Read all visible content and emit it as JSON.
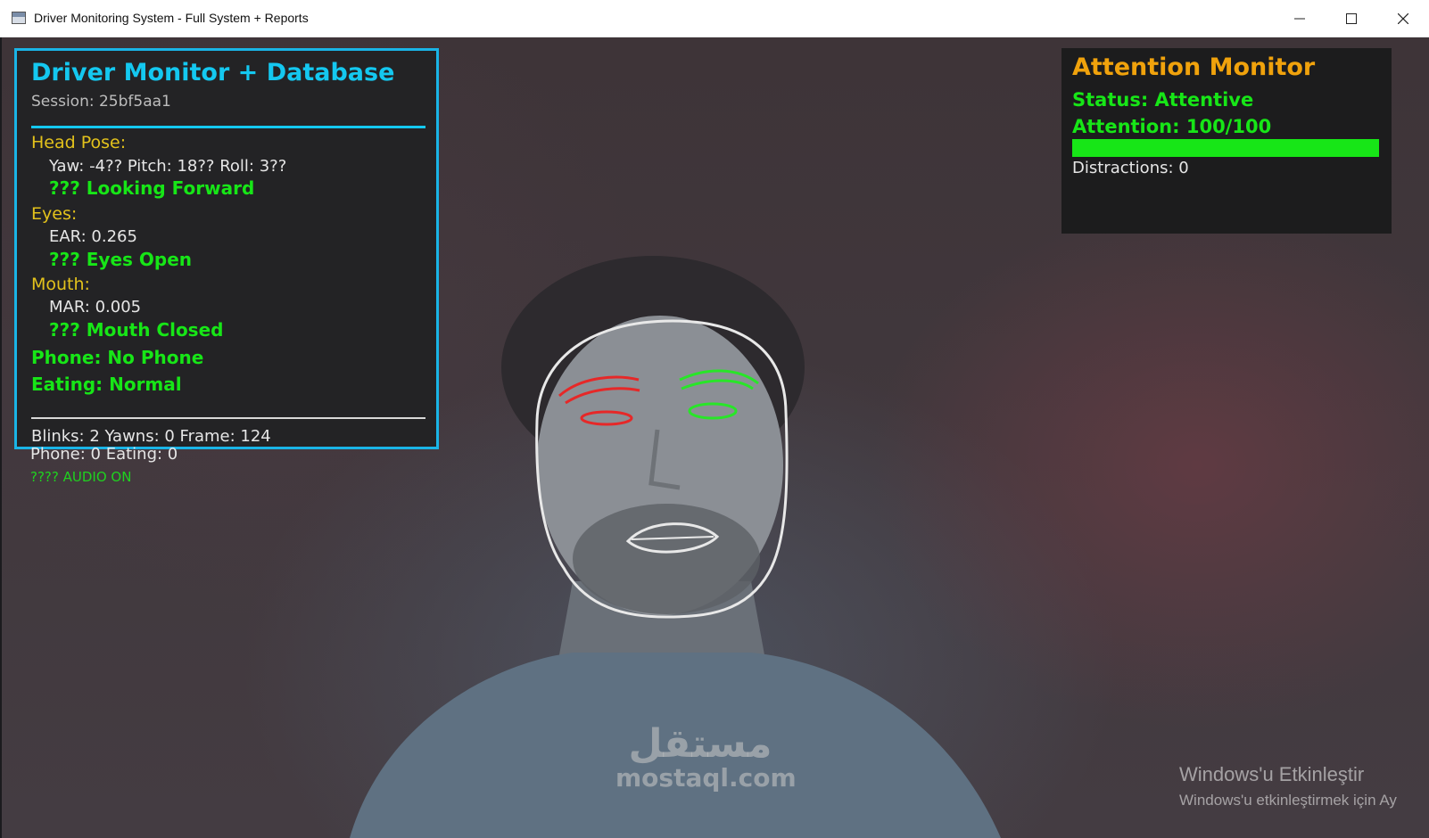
{
  "window": {
    "title": "Driver Monitoring System - Full System + Reports",
    "controls": [
      "minimize-icon",
      "maximize-icon",
      "close-icon"
    ]
  },
  "left_panel": {
    "title": "Driver Monitor + Database",
    "session": "Session: 25bf5aa1",
    "head_pose_label": "Head Pose:",
    "head_pose_values": "Yaw: -4??   Pitch: 18??   Roll: 3??",
    "head_pose_status": "??? Looking Forward",
    "eyes_label": "Eyes:",
    "ear_value": "EAR: 0.265",
    "eyes_status": "??? Eyes Open",
    "mouth_label": "Mouth:",
    "mar_value": "MAR: 0.005",
    "mouth_status": "??? Mouth Closed",
    "phone_status": "Phone: No Phone",
    "eating_status": "Eating: Normal",
    "counts_line": "Blinks: 2   Yawns: 0   Frame: 124"
  },
  "below_panel": {
    "counts_line2": "Phone: 0   Eating: 0",
    "audio_status": "???? AUDIO ON"
  },
  "attention_panel": {
    "title": "Attention Monitor",
    "status": "Status: Attentive",
    "attention": "Attention: 100/100",
    "attention_fraction": 1.0,
    "distractions": "Distractions: 0"
  },
  "overlay": {
    "face_outline_color": "#e8e8e8",
    "left_eye_color": "#e62828",
    "right_eye_color": "#28e628",
    "mouth_color": "#e8e8e8"
  },
  "watermark": {
    "arabic": "مستقل",
    "latin": "mostaql.com"
  },
  "activation_notice": {
    "line1": "Windows'u Etkinleştir",
    "line2": "Windows'u etkinleştirmek için Ay"
  },
  "colors": {
    "panel_border": "#1ab4e6",
    "title_cyan": "#14c8f0",
    "section_yellow": "#e3c21c",
    "ok_green": "#17e617",
    "attention_orange": "#f0a20c"
  }
}
